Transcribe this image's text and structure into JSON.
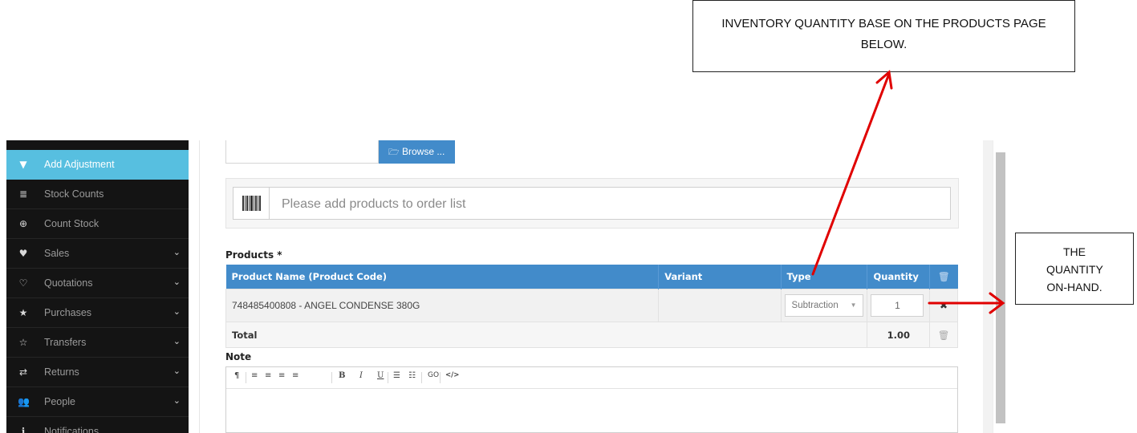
{
  "sidebar": {
    "items": [
      {
        "icon": "filter-icon",
        "glyph": "▼",
        "label": "Add Adjustment",
        "active": true
      },
      {
        "icon": "list-icon",
        "glyph": "≣",
        "label": "Stock Counts"
      },
      {
        "icon": "plus-circle-icon",
        "glyph": "⊕",
        "label": "Count Stock"
      },
      {
        "icon": "heart-icon",
        "glyph": "♥",
        "label": "Sales",
        "chevron": true
      },
      {
        "icon": "heart-outline-icon",
        "glyph": "♡",
        "label": "Quotations",
        "chevron": true
      },
      {
        "icon": "star-icon",
        "glyph": "★",
        "label": "Purchases",
        "chevron": true
      },
      {
        "icon": "star-outline-icon",
        "glyph": "☆",
        "label": "Transfers",
        "chevron": true
      },
      {
        "icon": "random-icon",
        "glyph": "⇄",
        "label": "Returns",
        "chevron": true
      },
      {
        "icon": "users-icon",
        "glyph": "👥",
        "label": "People",
        "chevron": true
      },
      {
        "icon": "info-icon",
        "glyph": "ℹ",
        "label": "Notifications"
      }
    ]
  },
  "upload": {
    "browse_label": "Browse ...",
    "browse_icon": "folder-open-icon"
  },
  "add_product": {
    "placeholder": "Please add products to order list",
    "icon": "barcode-icon"
  },
  "products": {
    "label": "Products *",
    "columns": [
      "Product Name (Product Code)",
      "Variant",
      "Type",
      "Quantity"
    ],
    "rows": [
      {
        "name": "748485400808 - ANGEL CONDENSE 380G",
        "variant": "",
        "type": "Subtraction",
        "quantity": "1"
      }
    ],
    "total_label": "Total",
    "total_value": "1.00"
  },
  "note": {
    "label": "Note",
    "toolbar": [
      "¶",
      "≡",
      "≡",
      "≡",
      "≡",
      "B",
      "I",
      "U",
      "☰",
      "☷",
      "GO",
      "</>"
    ]
  },
  "annotations": {
    "callout_top": "INVENTORY QUANTITY BASE ON THE PRODUCTS PAGE BELOW.",
    "callout_right": "THE QUANTITY ON-HAND.",
    "arrow_color": "#e00000"
  },
  "colors": {
    "primary": "#428bca",
    "sidebar_active": "#57bfe0",
    "sidebar_bg": "#141414"
  }
}
